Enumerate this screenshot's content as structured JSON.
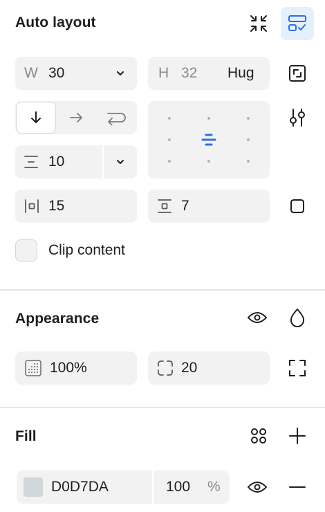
{
  "auto_layout": {
    "title": "Auto layout",
    "width": {
      "label": "W",
      "value": "30"
    },
    "height": {
      "label": "H",
      "value": "32",
      "mode": "Hug"
    },
    "gap": {
      "value": "10"
    },
    "padding_horizontal": {
      "value": "15"
    },
    "padding_vertical": {
      "value": "7"
    },
    "clip_content": {
      "label": "Clip content",
      "checked": false
    },
    "direction": "vertical",
    "alignment": "center"
  },
  "appearance": {
    "title": "Appearance",
    "opacity": "100%",
    "corner_radius": "20"
  },
  "fill": {
    "title": "Fill",
    "color_hex": "D0D7DA",
    "swatch_color": "#D0D7DA",
    "opacity": "100",
    "opacity_unit": "%"
  },
  "colors": {
    "accent": "#2f6fdf",
    "accent_bg": "#e5f0fd"
  }
}
